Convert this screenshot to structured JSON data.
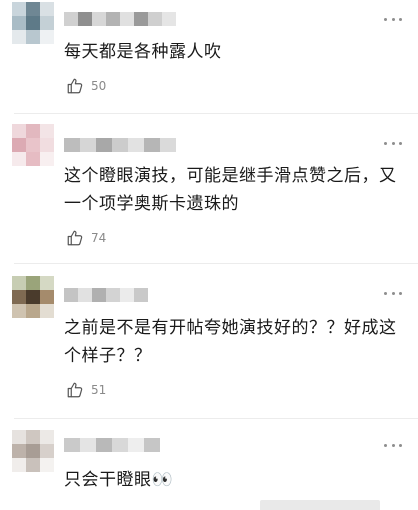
{
  "comments": [
    {
      "text": "每天都是各种露人吹",
      "likes": "50",
      "more_icon": "more-dots-icon"
    },
    {
      "text": "这个瞪眼演技，可能是继手滑点赞之后，又一个项学奥斯卡遗珠的",
      "likes": "74",
      "more_icon": "more-dots-icon"
    },
    {
      "text": "之前是不是有开帖夸她演技好的？？好成这个样子？？",
      "likes": "51",
      "more_icon": "more-dots-icon"
    },
    {
      "text": "只会干瞪眼👀",
      "likes": "",
      "more_icon": "more-dots-icon"
    }
  ],
  "icons": {
    "like": "thumbs-up-icon",
    "more": "more-dots-icon"
  },
  "colors": {
    "text": "#1a1a1a",
    "muted": "#8a8a8a",
    "divider": "#ececec"
  }
}
